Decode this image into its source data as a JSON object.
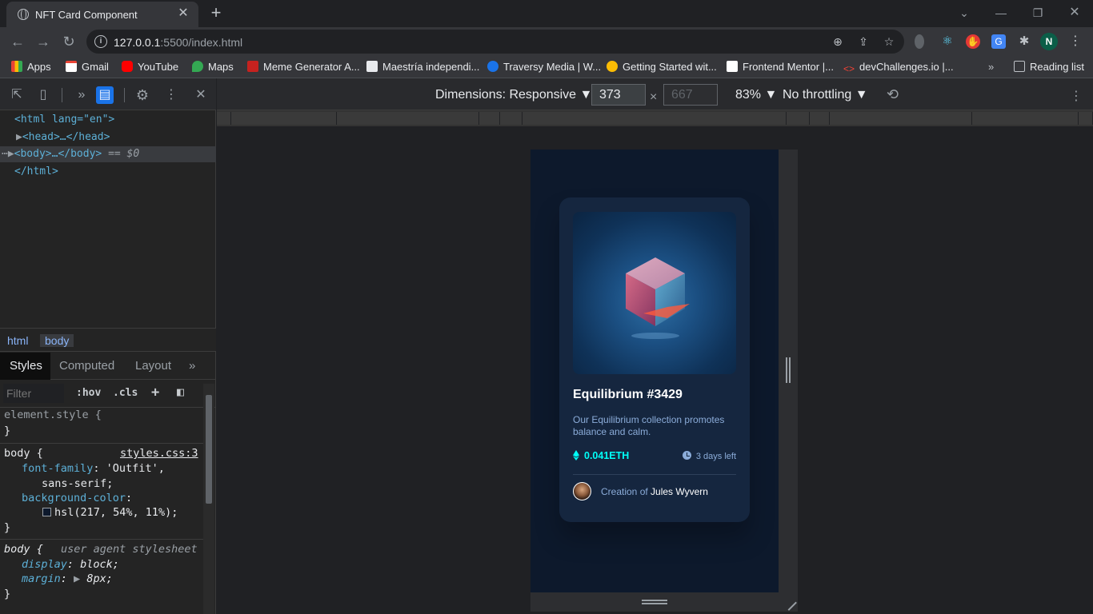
{
  "browser": {
    "tab_title": "NFT Card Component",
    "url_host": "127.0.0.1",
    "url_rest": ":5500/index.html",
    "profile_initial": "N"
  },
  "bookmarks": [
    {
      "label": "Apps",
      "icon": "apps-grid-icon",
      "color": "#ea4335"
    },
    {
      "label": "Gmail",
      "icon": "gmail-icon",
      "color": "#ea4335"
    },
    {
      "label": "YouTube",
      "icon": "youtube-icon",
      "color": "#ff0000"
    },
    {
      "label": "Maps",
      "icon": "maps-icon",
      "color": "#34a853"
    },
    {
      "label": "Meme Generator A...",
      "icon": "meme-icon",
      "color": "#c5221f"
    },
    {
      "label": "Maestría independi...",
      "icon": "maestria-icon",
      "color": "#1a73e8"
    },
    {
      "label": "Traversy Media | W...",
      "icon": "traversy-icon",
      "color": "#1a73e8"
    },
    {
      "label": "Getting Started wit...",
      "icon": "getting-started-icon",
      "color": "#fbbc04"
    },
    {
      "label": "Frontend Mentor |...",
      "icon": "frontend-mentor-icon",
      "color": "#ffffff"
    },
    {
      "label": "devChallenges.io |...",
      "icon": "devchallenges-icon",
      "color": "#f44336"
    }
  ],
  "reading_list": "Reading list",
  "devtools": {
    "dom": {
      "html_open": "<html lang=\"en\">",
      "head": "<head>…</head>",
      "body": "<body>…</body>",
      "body_marker": "== $0",
      "html_close": "</html>"
    },
    "breadcrumbs": [
      "html",
      "body"
    ],
    "style_tabs": [
      "Styles",
      "Computed",
      "Layout"
    ],
    "filter_placeholder": "Filter",
    "hov": ":hov",
    "cls": ".cls",
    "rules": {
      "element_style": "element.style {",
      "close": "}",
      "body_selector": "body {",
      "body_source": "styles.css:3",
      "font_family_prop": "font-family",
      "font_family_val1": "'Outfit',",
      "font_family_val2": "sans-serif;",
      "bg_prop": "background-color",
      "bg_val": "hsl(217, 54%, 11%);",
      "ua_selector": "body {",
      "ua_source": "user agent stylesheet",
      "display_prop": "display",
      "display_val": "block;",
      "margin_prop": "margin",
      "margin_val": "8px;"
    }
  },
  "device_toolbar": {
    "dimensions": "Dimensions: Responsive",
    "width": "373",
    "height": "667",
    "times": "×",
    "zoom": "83%",
    "throttling": "No throttling"
  },
  "card": {
    "title": "Equilibrium #3429",
    "description": "Our Equilibrium collection promotes balance and calm.",
    "price": "0.041ETH",
    "time_left": "3 days left",
    "creation_of": "Creation of",
    "creator_name": "Jules Wyvern",
    "colors": {
      "card_bg": "#15263f",
      "page_bg": "#0d192c",
      "cyan": "#00fff8",
      "soft_blue": "#8bacd9"
    }
  }
}
